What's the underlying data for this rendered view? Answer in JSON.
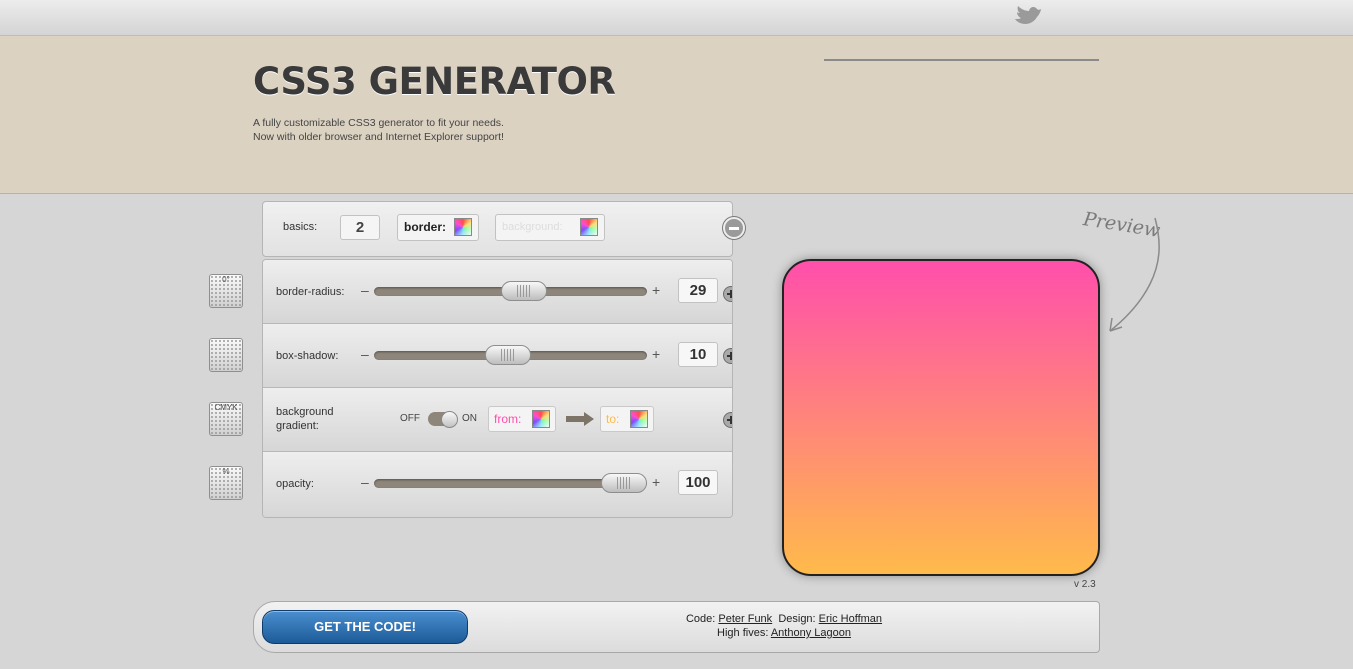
{
  "header": {
    "title": "CSS3 GENERATOR",
    "tagline_line1": "A fully customizable CSS3 generator to fit your needs.",
    "tagline_line2": "Now with older browser and Internet Explorer support!"
  },
  "basics": {
    "label": "basics:",
    "count": "2",
    "border_label": "border:",
    "background_label": "background:"
  },
  "controls": {
    "border_radius": {
      "label": "border-radius:",
      "value": "29",
      "level": 0.56
    },
    "box_shadow": {
      "label": "box-shadow:",
      "value": "10",
      "level": 0.49
    },
    "background_gradient": {
      "label_line1": "background",
      "label_line2": "gradient:",
      "off": "OFF",
      "on": "ON",
      "from_label": "from:",
      "to_label": "to:",
      "from_color": "#ff4fab",
      "to_color": "#ffba4b"
    },
    "opacity": {
      "label": "opacity:",
      "value": "100",
      "level": 1.0
    },
    "minus": "–",
    "plus": "+"
  },
  "side_icons": {
    "rotate": "0°",
    "cmyk": "CMYK",
    "percent": "%"
  },
  "preview": {
    "label": "Preview",
    "version": "v 2.3"
  },
  "footer": {
    "get_code": "GET THE CODE!",
    "code_label": "Code:",
    "code_author": "Peter Funk",
    "design_label": "Design:",
    "design_author": "Eric Hoffman",
    "high_fives_label": "High fives:",
    "high_fives_name": "Anthony Lagoon"
  },
  "colors": {
    "header_bg": "#dcd2c2",
    "accent_blue": "#1d5b98"
  }
}
